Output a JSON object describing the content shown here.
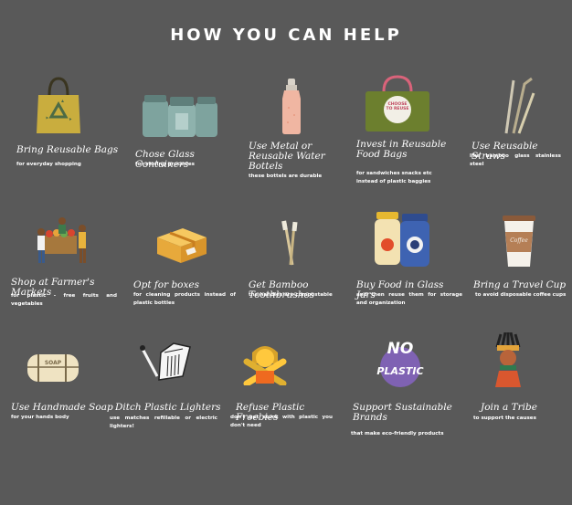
{
  "title": "HOW YOU CAN HELP",
  "items": [
    {
      "label": "Bring Reusable Bags",
      "desc": "for everyday shopping"
    },
    {
      "label": "Chose Glass Containers",
      "desc": "for storing groceries"
    },
    {
      "label": "Use Metal or Reusable Water Bottels",
      "desc": "these bottels are durable"
    },
    {
      "label": "Invest in Reusable Food Bags",
      "desc": "for sandwiches snacks etc instead of plastic baggies"
    },
    {
      "label": "Use Reusable Straws",
      "desc": "like bamboo glass stainless steel"
    },
    {
      "label": "Shop at Farmer's Markets",
      "desc": "for plastic - free fruits and vegetables"
    },
    {
      "label": "Opt for boxes",
      "desc": "for cleaning products instead of plastic bottles"
    },
    {
      "label": "Get Bamboo Toothbrushes",
      "desc": "the handles are compostable"
    },
    {
      "label": "Buy Food in Glass Jars",
      "desc": "and then reuse them for storage and organization"
    },
    {
      "label": "Bring a Travel Cup",
      "desc": "to avoid disposable coffee cups"
    },
    {
      "label": "Use Handmade Soap",
      "desc": "for your hands body"
    },
    {
      "label": "Ditch Plastic Lighters",
      "desc": "use matches refillable or electric lighters!"
    },
    {
      "label": "Refuse Plastic Freebies",
      "desc": "don't get stuck with plastic you don't need"
    },
    {
      "label": "Support Sustainable Brands",
      "desc": "that make eco-friendly products"
    },
    {
      "label": "Join a Tribe",
      "desc": "to support the causes"
    }
  ],
  "icon_text": {
    "bag_badge": "CHOOSE TO REUSE",
    "cup_brand": "Coffee",
    "soap_stamp": "SOAP",
    "no_plastic_top": "NO",
    "no_plastic_bottom": "PLASTIC"
  },
  "colors": {
    "background": "#595959",
    "text": "#ffffff"
  }
}
